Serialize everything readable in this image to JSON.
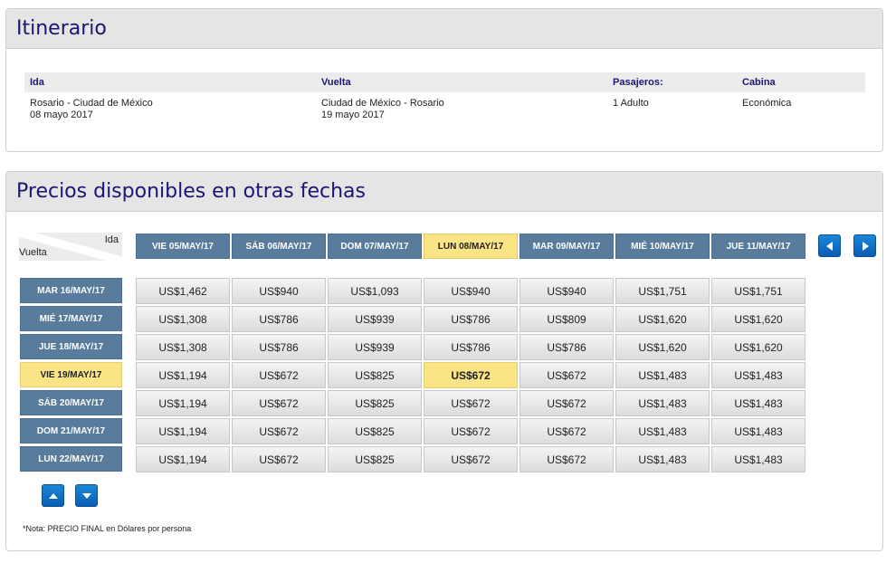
{
  "itinerario": {
    "title": "Itinerario",
    "headers": {
      "ida": "Ida",
      "vuelta": "Vuelta",
      "pasajeros": "Pasajeros:",
      "cabina": "Cabina"
    },
    "ida_route": "Rosario - Ciudad de México",
    "ida_date": "08 mayo 2017",
    "vuelta_route": "Ciudad de México - Rosario",
    "vuelta_date": "19 mayo 2017",
    "pasajeros": "1 Adulto",
    "cabina": "Económica"
  },
  "precios": {
    "title": "Precios disponibles en otras fechas",
    "corner_ida": "Ida",
    "corner_vuelta": "Vuelta",
    "columns": [
      "VIE 05/MAY/17",
      "SÁB 06/MAY/17",
      "DOM 07/MAY/17",
      "LUN 08/MAY/17",
      "MAR 09/MAY/17",
      "MIÉ 10/MAY/17",
      "JUE 11/MAY/17"
    ],
    "rows": [
      "MAR 16/MAY/17",
      "MIÉ 17/MAY/17",
      "JUE 18/MAY/17",
      "VIE 19/MAY/17",
      "SÁB 20/MAY/17",
      "DOM 21/MAY/17",
      "LUN 22/MAY/17"
    ],
    "prices": [
      [
        "US$1,462",
        "US$940",
        "US$1,093",
        "US$940",
        "US$940",
        "US$1,751",
        "US$1,751"
      ],
      [
        "US$1,308",
        "US$786",
        "US$939",
        "US$786",
        "US$809",
        "US$1,620",
        "US$1,620"
      ],
      [
        "US$1,308",
        "US$786",
        "US$939",
        "US$786",
        "US$786",
        "US$1,620",
        "US$1,620"
      ],
      [
        "US$1,194",
        "US$672",
        "US$825",
        "US$672",
        "US$672",
        "US$1,483",
        "US$1,483"
      ],
      [
        "US$1,194",
        "US$672",
        "US$825",
        "US$672",
        "US$672",
        "US$1,483",
        "US$1,483"
      ],
      [
        "US$1,194",
        "US$672",
        "US$825",
        "US$672",
        "US$672",
        "US$1,483",
        "US$1,483"
      ],
      [
        "US$1,194",
        "US$672",
        "US$825",
        "US$672",
        "US$672",
        "US$1,483",
        "US$1,483"
      ]
    ],
    "selected_column": 3,
    "selected_row": 3,
    "nota": "*Nota: PRECIO FINAL en Dólares por persona"
  },
  "colors": {
    "title": "#1b1574",
    "header_blue": "#5a7c9c",
    "highlight": "#fbe486",
    "nav_button": "#0b6fc6"
  },
  "icons": {
    "prev": "arrow-left-icon",
    "next": "arrow-right-icon",
    "up": "arrow-up-icon",
    "down": "arrow-down-icon"
  }
}
